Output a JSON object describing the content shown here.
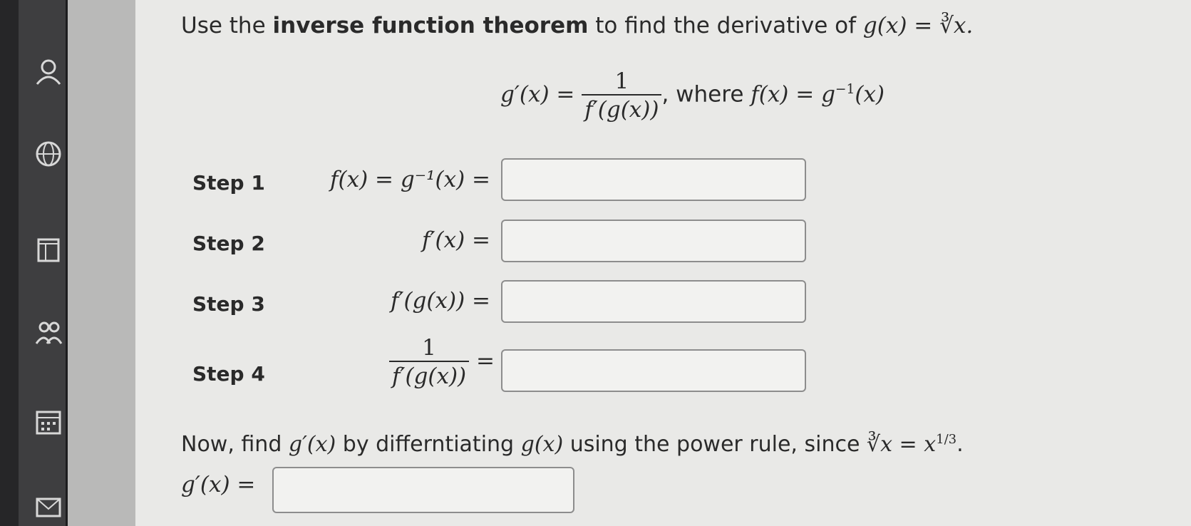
{
  "sidebar": {
    "icons": [
      "user-icon",
      "globe-icon",
      "book-icon",
      "group-icon",
      "calendar-icon",
      "mail-icon"
    ]
  },
  "question": {
    "prefix": "Use the ",
    "bold": "inverse function theorem",
    "suffix": " to find the derivative of ",
    "func": "g(x) = ∛x."
  },
  "formula": {
    "lhs": "g′(x) =",
    "num": "1",
    "den": "f′(g(x))",
    "where": ", where ",
    "rhs": "f(x) = g",
    "rhs_sup": "−1",
    "rhs_end": "(x)"
  },
  "steps": [
    {
      "label": "Step 1",
      "expr": "f(x) = g⁻¹(x) =",
      "value": ""
    },
    {
      "label": "Step 2",
      "expr": "f′(x) =",
      "value": ""
    },
    {
      "label": "Step 3",
      "expr": "f′(g(x)) =",
      "value": ""
    },
    {
      "label": "Step 4",
      "expr_num": "1",
      "expr_den": "f′(g(x))",
      "expr_eq": "=",
      "value": ""
    }
  ],
  "power_rule": {
    "text1": "Now, find ",
    "g1": "g′(x)",
    "text2": " by differntiating ",
    "g2": "g(x)",
    "text3": " using the power rule, since ",
    "eq": "∛x = x",
    "exp": "1/3",
    "end": "."
  },
  "final": {
    "label": "g′(x) =",
    "value": ""
  }
}
